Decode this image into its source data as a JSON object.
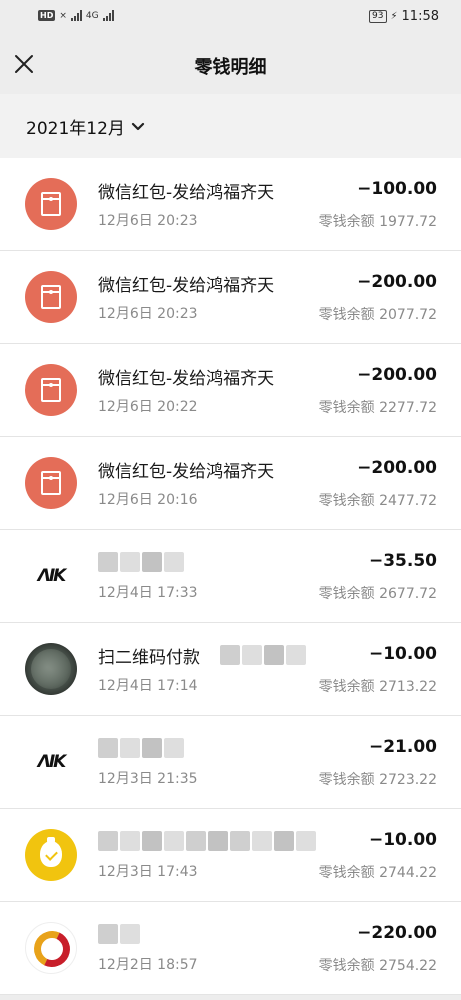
{
  "status_bar": {
    "hd": "HD",
    "network_left": "×",
    "network_right": "4G",
    "battery": "93",
    "time": "11:58"
  },
  "header": {
    "title": "零钱明细",
    "close_icon": "close-icon"
  },
  "filter": {
    "month": "2021年12月",
    "dropdown_icon": "chevron-down-icon"
  },
  "transactions": [
    {
      "avatar": "red-packet-icon",
      "title": "微信红包-发给鸿福齐天",
      "time": "12月6日 20:23",
      "amount": "−100.00",
      "balance": "零钱余额 1977.72"
    },
    {
      "avatar": "red-packet-icon",
      "title": "微信红包-发给鸿福齐天",
      "time": "12月6日 20:23",
      "amount": "−200.00",
      "balance": "零钱余额 2077.72"
    },
    {
      "avatar": "red-packet-icon",
      "title": "微信红包-发给鸿福齐天",
      "time": "12月6日 20:22",
      "amount": "−200.00",
      "balance": "零钱余额 2277.72"
    },
    {
      "avatar": "red-packet-icon",
      "title": "微信红包-发给鸿福齐天",
      "time": "12月6日 20:16",
      "amount": "−200.00",
      "balance": "零钱余额 2477.72"
    },
    {
      "avatar": "merchant-logo",
      "logo_text": "ΛΙΚ",
      "title": "",
      "time": "12月4日 17:33",
      "amount": "−35.50",
      "balance": "零钱余额 2677.72"
    },
    {
      "avatar": "user-photo",
      "title": "扫二维码付款",
      "time": "12月4日 17:14",
      "amount": "−10.00",
      "balance": "零钱余额 2713.22"
    },
    {
      "avatar": "merchant-logo",
      "logo_text": "ΛΙΚ",
      "title": "",
      "time": "12月3日 21:35",
      "amount": "−21.00",
      "balance": "零钱余额 2723.22"
    },
    {
      "avatar": "gold-bag-icon",
      "title": "",
      "time": "12月3日 17:43",
      "amount": "−10.00",
      "balance": "零钱余额 2744.22"
    },
    {
      "avatar": "bank-logo",
      "title": "",
      "time": "12月2日 18:57",
      "amount": "−220.00",
      "balance": "零钱余额 2754.22"
    }
  ]
}
